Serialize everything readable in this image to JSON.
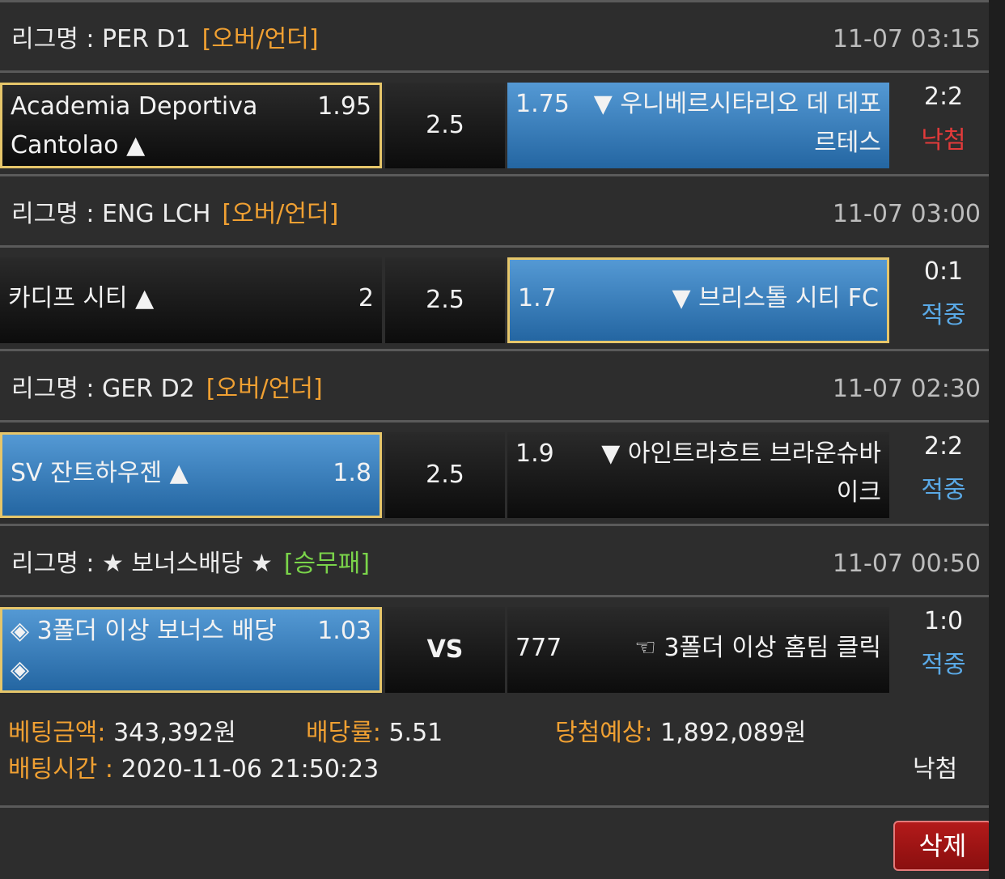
{
  "bets": [
    {
      "league_label": "리그명 : PER D1",
      "bet_type": "[오버/언더]",
      "time": "11-07 03:15",
      "home_line1": "Academia Deportiva",
      "home_line2": "Cantolao ▲",
      "home_odds": "1.95",
      "middle": "2.5",
      "away_odds": "1.75",
      "away_line1": "▼ 우니베르시타리오 데 데포",
      "away_line2": "르테스",
      "score": "2:2",
      "status": "낙첨"
    },
    {
      "league_label": "리그명 : ENG LCH",
      "bet_type": "[오버/언더]",
      "time": "11-07 03:00",
      "home_name": "카디프 시티 ▲",
      "home_odds": "2",
      "middle": "2.5",
      "away_odds": "1.7",
      "away_name": "▼ 브리스톨 시티 FC",
      "score": "0:1",
      "status": "적중"
    },
    {
      "league_label": "리그명 : GER D2",
      "bet_type": "[오버/언더]",
      "time": "11-07 02:30",
      "home_name": "SV 잔트하우젠 ▲",
      "home_odds": "1.8",
      "middle": "2.5",
      "away_odds": "1.9",
      "away_line1": "▼ 아인트라흐트 브라운슈바",
      "away_line2": "이크",
      "score": "2:2",
      "status": "적중"
    },
    {
      "league_label": "리그명 : ★ 보너스배당 ★",
      "bet_type": "[승무패]",
      "time": "11-07 00:50",
      "home_line1": "◈ 3폴더 이상 보너스 배당",
      "home_line2": "◈",
      "home_odds": "1.03",
      "middle": "VS",
      "away_odds": "777",
      "away_name": "☜ 3폴더 이상 홈팀 클릭",
      "score": "1:0",
      "status": "적중"
    }
  ],
  "summary": {
    "bet_amount_label": "베팅금액:",
    "bet_amount": "343,392원",
    "odds_label": "배당률:",
    "odds": "5.51",
    "expected_label": "당첨예상:",
    "expected": "1,892,089원",
    "time_label": "배팅시간 :",
    "time": "2020-11-06 21:50:23",
    "status": "낙첨"
  },
  "delete_label": "삭제",
  "colors": {
    "selected_blue": "#3a7fc0",
    "frame_gold": "#e6c66a",
    "bet_type_orange": "#f0a032",
    "bet_type_green": "#7ad44a",
    "win": "#5aa9e6",
    "lose": "#e23a3a"
  }
}
